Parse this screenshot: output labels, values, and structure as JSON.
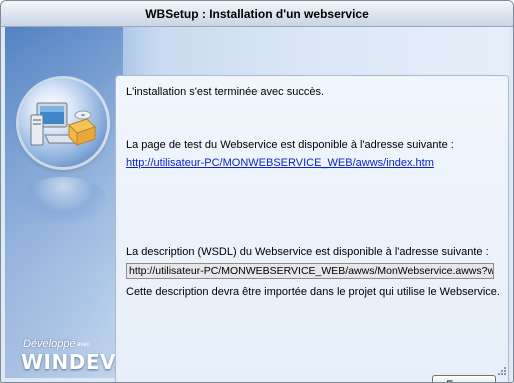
{
  "window": {
    "title": "WBSetup : Installation d'un webservice"
  },
  "main": {
    "success_message": "L'installation s'est terminée avec succès.",
    "test_page_label": "La page de test du Webservice est disponible à l'adresse suivante :",
    "test_page_link": "http://utilisateur-PC/MONWEBSERVICE_WEB/awws/index.htm",
    "wsdl_label": "La description (WSDL) du Webservice est disponible à l'adresse suivante :",
    "wsdl_value": "http://utilisateur-PC/MONWEBSERVICE_WEB/awws/MonWebservice.awws?wsdl",
    "import_note": "Cette description devra être importée dans le projet qui utilise le Webservice."
  },
  "buttons": {
    "close_label": "Fermer"
  },
  "branding": {
    "developed_label": "Développé",
    "avec_label": "avec",
    "product_label": "WINDEV."
  },
  "icons": {
    "illustration": "computer-setup-icon",
    "resize": "resize-grip-icon"
  },
  "colors": {
    "link": "#0b24c8",
    "accent_blue": "#5e89c6"
  }
}
